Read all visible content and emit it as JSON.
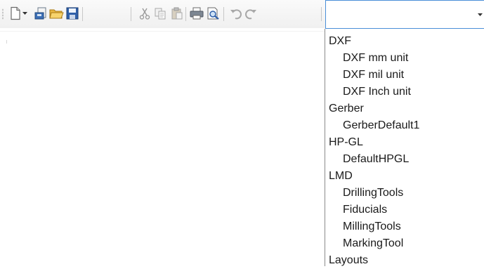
{
  "toolbar": {
    "buttons": [
      {
        "name": "new-document-icon"
      },
      {
        "name": "dropdown-arrow-icon"
      },
      {
        "name": "import-icon"
      },
      {
        "name": "open-folder-icon"
      },
      {
        "name": "save-icon"
      },
      {
        "name": "cut-icon"
      },
      {
        "name": "copy-icon"
      },
      {
        "name": "paste-icon"
      },
      {
        "name": "print-icon"
      },
      {
        "name": "print-preview-icon"
      },
      {
        "name": "undo-icon"
      },
      {
        "name": "redo-icon"
      }
    ]
  },
  "combo": {
    "value": "",
    "open": true
  },
  "dropdown": {
    "items": [
      {
        "label": "DXF",
        "level": "group"
      },
      {
        "label": "DXF mm unit",
        "level": "child"
      },
      {
        "label": "DXF mil unit",
        "level": "child"
      },
      {
        "label": "DXF Inch unit",
        "level": "child"
      },
      {
        "label": "Gerber",
        "level": "group"
      },
      {
        "label": "GerberDefault1",
        "level": "child"
      },
      {
        "label": "HP-GL",
        "level": "group"
      },
      {
        "label": "DefaultHPGL",
        "level": "child"
      },
      {
        "label": "LMD",
        "level": "group"
      },
      {
        "label": "DrillingTools",
        "level": "child"
      },
      {
        "label": "Fiducials",
        "level": "child"
      },
      {
        "label": "MillingTools",
        "level": "child"
      },
      {
        "label": "MarkingTool",
        "level": "child"
      },
      {
        "label": "Layouts",
        "level": "group"
      }
    ]
  },
  "colors": {
    "focus_border": "#4a8fd8",
    "separator": "#c8c8c8",
    "dropdown_border": "#8a8a8a"
  }
}
